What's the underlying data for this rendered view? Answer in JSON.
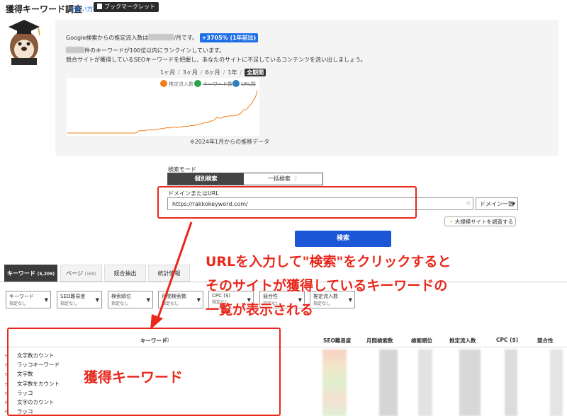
{
  "header": {
    "title": "獲得キーワード調査",
    "usage_link": "(使い方)",
    "bookmarklet": "ブックマークレット"
  },
  "summary": {
    "line1_prefix": "Google検索からの推定流入数は",
    "line1_suffix": "/月です。",
    "growth_badge": "+3705% (1年前比)",
    "line2_suffix": "件のキーワードが100位以内にランクインしています。",
    "line3": "競合サイトが獲得しているSEOキーワードを把握し、あなたのサイトに不足しているコンテンツを洗い出しましょう。"
  },
  "chart": {
    "periods": [
      "1ヶ月",
      "3ヶ月",
      "6ヶ月",
      "1年"
    ],
    "period_active": "全期間",
    "legend": [
      {
        "name": "推定流入数",
        "color": "#f07f1d"
      },
      {
        "name": "キーワード数",
        "color": "#2aa44a"
      },
      {
        "name": "URL数",
        "color": "#2a7fc2"
      }
    ],
    "note": "※2024年1月からの推移データ"
  },
  "chart_data": {
    "type": "line",
    "series": [
      {
        "name": "推定流入数",
        "values": [
          0,
          0,
          0,
          0,
          0,
          0,
          0,
          0,
          0,
          0,
          0,
          0,
          0,
          0,
          0,
          0,
          0,
          0,
          0,
          0,
          0,
          0,
          0,
          0,
          0,
          0,
          0,
          0,
          0,
          0,
          0,
          0,
          0,
          0,
          0,
          0,
          0,
          0,
          0,
          0,
          2,
          3,
          3,
          3,
          3,
          4,
          4,
          4,
          4,
          4,
          5,
          5,
          5,
          6,
          6,
          6,
          7,
          7,
          7,
          7,
          8,
          8,
          7,
          8,
          8,
          8,
          9,
          9,
          9,
          9,
          10,
          10,
          10,
          11,
          11,
          12,
          12,
          13,
          14,
          14,
          14,
          16,
          16,
          17,
          18,
          21,
          20,
          20,
          20,
          22,
          22,
          22,
          23,
          23,
          23,
          23,
          24,
          24,
          26,
          27,
          31,
          31,
          32,
          35,
          38,
          40,
          45,
          48,
          57
        ]
      }
    ],
    "note": "values are relative (axis not shown)"
  },
  "search": {
    "mode_label": "検索モード",
    "mode_individual": "個別検索",
    "mode_bulk": "一括検索",
    "domain_label": "ドメインまたはURL",
    "url_value": "https://rakkokeyword.com/",
    "clear": "×",
    "match_option": "ドメイン一致",
    "large_site": "大規模サイトを調査する",
    "submit": "検索"
  },
  "annotations": {
    "line1": "URLを入力して\"検索\"をクリックすると",
    "line2": "そのサイトが獲得しているキーワードの",
    "line3": "一覧が表示される",
    "keywords": "獲得キーワード"
  },
  "result_tabs": [
    {
      "label": "キーワード",
      "count": "(5,209)"
    },
    {
      "label": "ページ",
      "count": "(169)"
    },
    {
      "label": "競合抽出",
      "count": ""
    },
    {
      "label": "統計情報",
      "count": ""
    }
  ],
  "filters": [
    {
      "label": "キーワード",
      "sub": "指定なし"
    },
    {
      "label": "SEO難易度",
      "sub": "指定なし"
    },
    {
      "label": "検索順位",
      "sub": "指定なし"
    },
    {
      "label": "月間検索数",
      "sub": "指定なし"
    },
    {
      "label": "CPC ($)",
      "sub": "指定なし"
    },
    {
      "label": "競合性",
      "sub": "指定なし"
    },
    {
      "label": "推定流入数",
      "sub": "指定なし"
    }
  ],
  "table": {
    "headers": [
      "キーワード",
      "SEO難易度",
      "月間検索数",
      "検索順位",
      "推定流入数",
      "CPC ($)",
      "競合性"
    ],
    "rows": [
      "文字数カウント",
      "ラッコキーワード",
      "文字数",
      "文字数をカウント",
      "ラッコ",
      "文字のカウント",
      "ラッコ"
    ]
  },
  "icons": {
    "bookmark": "bookmark-icon",
    "info": "info-icon",
    "bolt": "bolt-icon",
    "drag": "drag-handle-icon"
  }
}
